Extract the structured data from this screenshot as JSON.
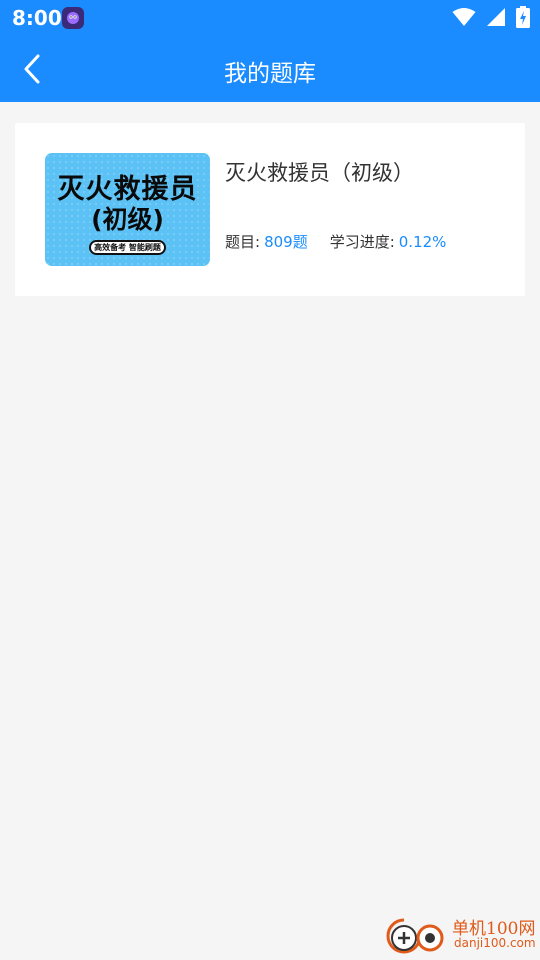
{
  "status_bar": {
    "time": "8:00",
    "icons": [
      "app-notification-icon",
      "wifi-icon",
      "signal-icon",
      "battery-charging-icon"
    ]
  },
  "header": {
    "title": "我的题库",
    "back_icon": "chevron-left-icon"
  },
  "bank_list": [
    {
      "cover": {
        "line1": "灭火救援员",
        "line2": "(初级)",
        "tag": "高效备考 智能刷题"
      },
      "title": "灭火救援员（初级）",
      "questions_label": "题目:",
      "questions_value": "809题",
      "progress_label": "学习进度:",
      "progress_value": "0.12%"
    }
  ],
  "watermark": {
    "name": "单机100网",
    "url": "danji100.com"
  },
  "colors": {
    "primary": "#1a8cff",
    "background": "#f5f5f5",
    "cover_bg": "#5cc2f5",
    "watermark": "#e05a1a"
  }
}
